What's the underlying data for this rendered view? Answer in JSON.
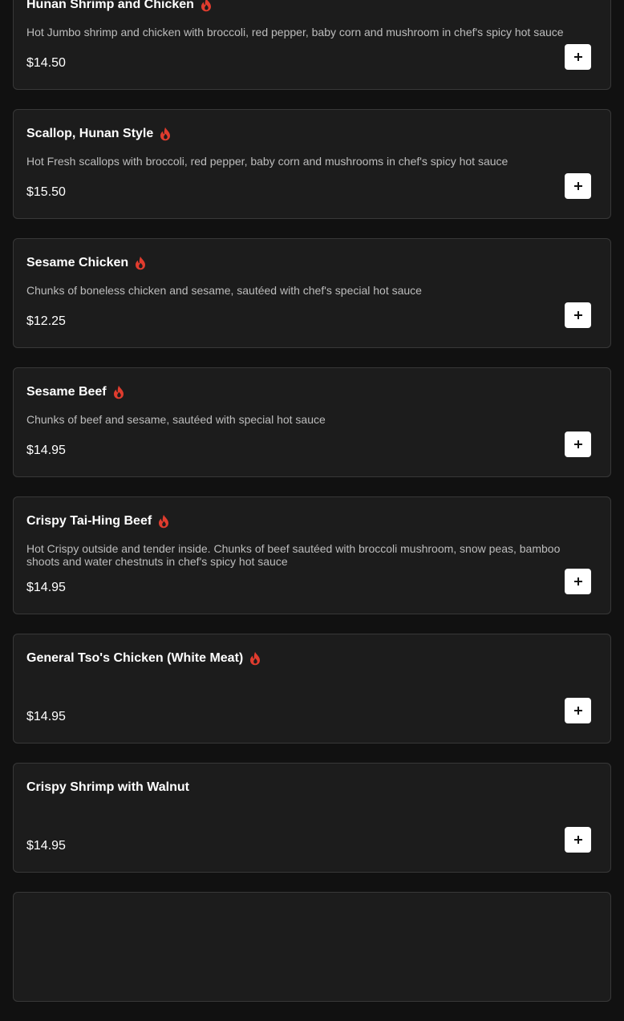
{
  "colors": {
    "background": "#111111",
    "card": "#1c1c1c",
    "card_border": "#383838",
    "spicy_icon": "#e03c2e",
    "add_button": "#ffffff"
  },
  "items": [
    {
      "name": "Hunan Shrimp and Chicken",
      "spicy": true,
      "description": "Hot Jumbo shrimp and chicken with broccoli, red pepper, baby corn and mushroom in chef's spicy hot sauce",
      "price": "$14.50",
      "icon": "flame-icon",
      "add_icon": "plus-icon"
    },
    {
      "name": "Scallop, Hunan Style",
      "spicy": true,
      "description": "Hot Fresh scallops with broccoli, red pepper, baby corn and mushrooms in chef's spicy hot sauce",
      "price": "$15.50",
      "icon": "flame-icon",
      "add_icon": "plus-icon"
    },
    {
      "name": "Sesame Chicken",
      "spicy": true,
      "description": "Chunks of boneless chicken and sesame, sautéed with chef's special hot sauce",
      "price": "$12.25",
      "icon": "flame-icon",
      "add_icon": "plus-icon"
    },
    {
      "name": "Sesame Beef",
      "spicy": true,
      "description": "Chunks of beef and sesame, sautéed with special hot sauce",
      "price": "$14.95",
      "icon": "flame-icon",
      "add_icon": "plus-icon"
    },
    {
      "name": "Crispy Tai-Hing Beef",
      "spicy": true,
      "description": "Hot Crispy outside and tender inside. Chunks of beef sautéed with broccoli mushroom, snow peas, bamboo shoots and water chestnuts in chef's spicy hot sauce",
      "price": "$14.95",
      "icon": "flame-icon",
      "add_icon": "plus-icon"
    },
    {
      "name": "General Tso's Chicken (White Meat)",
      "spicy": true,
      "description": "",
      "price": "$14.95",
      "icon": "flame-icon",
      "add_icon": "plus-icon"
    },
    {
      "name": "Crispy Shrimp with Walnut",
      "spicy": false,
      "description": "",
      "price": "$14.95",
      "add_icon": "plus-icon"
    }
  ]
}
